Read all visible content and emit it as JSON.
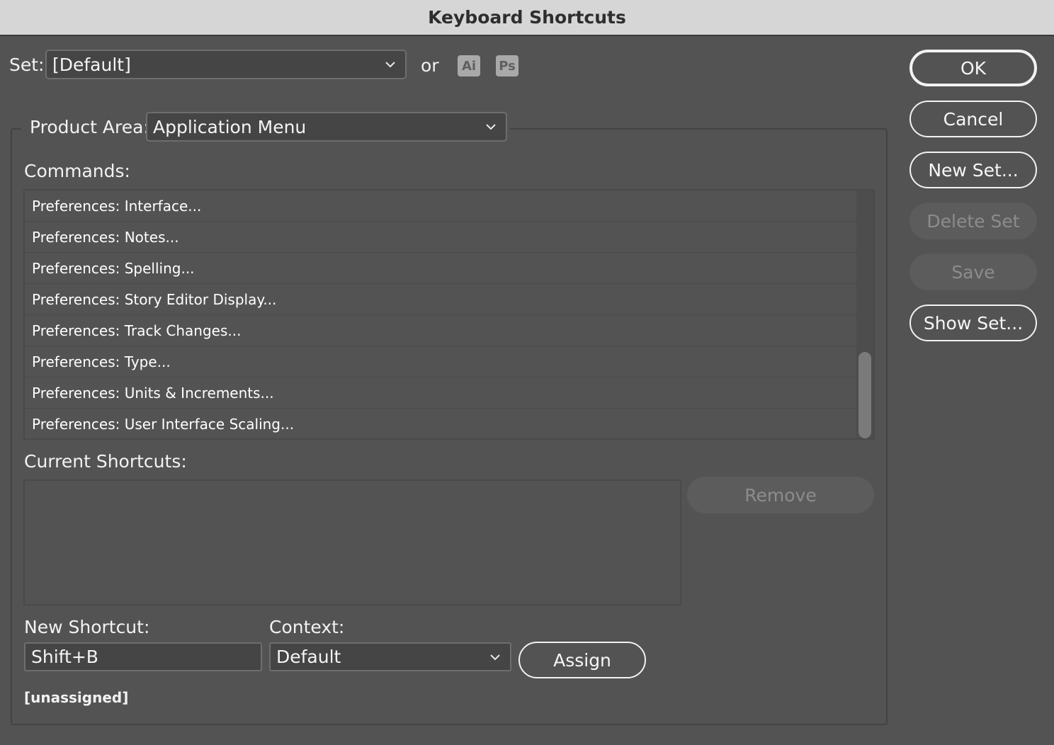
{
  "window": {
    "title": "Keyboard Shortcuts"
  },
  "set": {
    "label": "Set:",
    "value": "[Default]",
    "or_label": "or",
    "badges": [
      {
        "text": "Ai",
        "app": "Illustrator"
      },
      {
        "text": "Ps",
        "app": "Photoshop"
      }
    ]
  },
  "product_area": {
    "label": "Product Area:",
    "value": "Application Menu"
  },
  "commands": {
    "label": "Commands:",
    "items": [
      "Preferences: Interface...",
      "Preferences: Notes...",
      "Preferences: Spelling...",
      "Preferences: Story Editor Display...",
      "Preferences: Track Changes...",
      "Preferences: Type...",
      "Preferences: Units & Increments...",
      "Preferences: User Interface Scaling..."
    ]
  },
  "current_shortcuts": {
    "label": "Current Shortcuts:",
    "remove_label": "Remove"
  },
  "new_shortcut": {
    "label": "New Shortcut:",
    "value": "Shift+B",
    "status": "[unassigned]"
  },
  "context": {
    "label": "Context:",
    "value": "Default"
  },
  "assign_label": "Assign",
  "side_buttons": {
    "ok": "OK",
    "cancel": "Cancel",
    "new_set": "New Set...",
    "delete_set": "Delete Set",
    "save": "Save",
    "show_set": "Show Set..."
  },
  "colors": {
    "dialog_bg": "#535353",
    "titlebar_bg": "#d6d6d6",
    "field_bg": "#454545",
    "disabled_text": "#8c8c8c"
  },
  "icons": {
    "dropdown": "chevron-down-icon"
  }
}
